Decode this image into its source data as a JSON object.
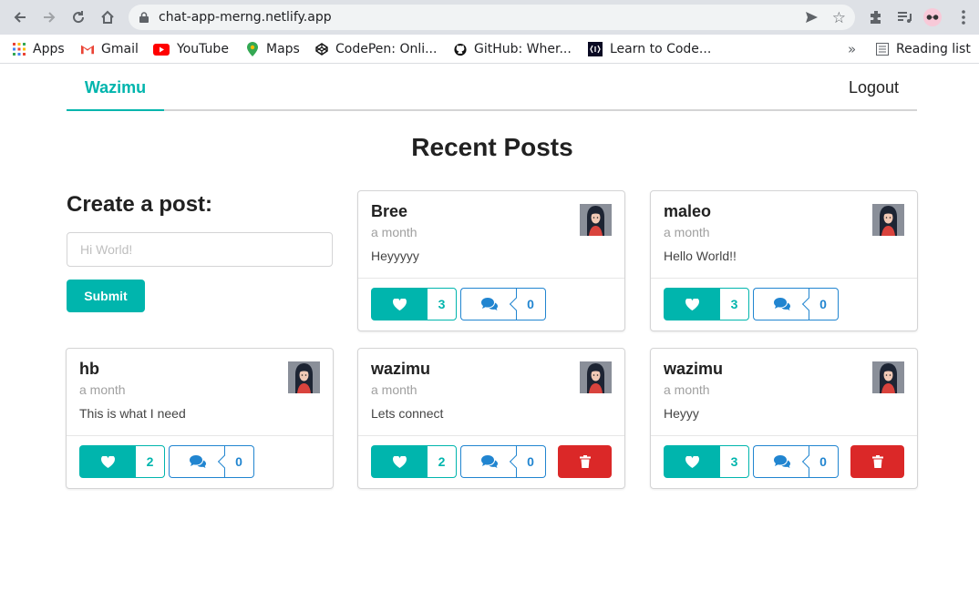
{
  "browser": {
    "url": "chat-app-merng.netlify.app",
    "bookmarks": [
      {
        "label": "Apps"
      },
      {
        "label": "Gmail"
      },
      {
        "label": "YouTube"
      },
      {
        "label": "Maps"
      },
      {
        "label": "CodePen: Onli..."
      },
      {
        "label": "GitHub: Wher..."
      },
      {
        "label": "Learn to Code..."
      }
    ],
    "more_label": "»",
    "reading_list": "Reading list"
  },
  "nav": {
    "brand": "Wazimu",
    "logout": "Logout"
  },
  "page_title": "Recent Posts",
  "create": {
    "title": "Create a post:",
    "placeholder": "Hi World!",
    "value": "",
    "submit": "Submit"
  },
  "posts": [
    {
      "author": "Bree",
      "time": "a month",
      "body": "Heyyyyy",
      "likes": "3",
      "comments": "0",
      "deletable": false
    },
    {
      "author": "maleo",
      "time": "a month",
      "body": "Hello World!!",
      "likes": "3",
      "comments": "0",
      "deletable": false
    },
    {
      "author": "hb",
      "time": "a month",
      "body": "This is what I need",
      "likes": "2",
      "comments": "0",
      "deletable": false
    },
    {
      "author": "wazimu",
      "time": "a month",
      "body": "Lets connect",
      "likes": "2",
      "comments": "0",
      "deletable": true
    },
    {
      "author": "wazimu",
      "time": "a month",
      "body": "Heyyy",
      "likes": "3",
      "comments": "0",
      "deletable": true
    }
  ],
  "colors": {
    "teal": "#00b5ad",
    "blue": "#2185d0",
    "red": "#db2828"
  }
}
